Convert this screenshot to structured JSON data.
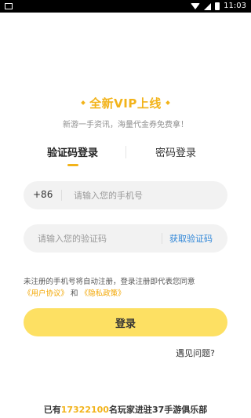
{
  "status_bar": {
    "time": "11:03"
  },
  "promo": {
    "title": "全新VIP上线",
    "subtitle": "新游一手资讯，海量代金券免费拿！"
  },
  "tabs": [
    {
      "label": "验证码登录",
      "active": true
    },
    {
      "label": "密码登录",
      "active": false
    }
  ],
  "phone": {
    "prefix": "+86",
    "placeholder": "请输入您的手机号"
  },
  "code": {
    "placeholder": "请输入您的验证码",
    "get_code_label": "获取验证码"
  },
  "agreement": {
    "text": "未注册的手机号将自动注册，登录注册即代表您同意",
    "user_agreement": "《用户协议》",
    "and": "和",
    "privacy_policy": "《隐私政策》"
  },
  "login_button": "登录",
  "help_link": "遇见问题?",
  "footer": {
    "prefix": "已有",
    "count": "17322100",
    "suffix": "名玩家进驻37手游俱乐部"
  },
  "colors": {
    "accent": "#f2b31a",
    "button": "#fde063",
    "link_blue": "#2f86d8"
  }
}
